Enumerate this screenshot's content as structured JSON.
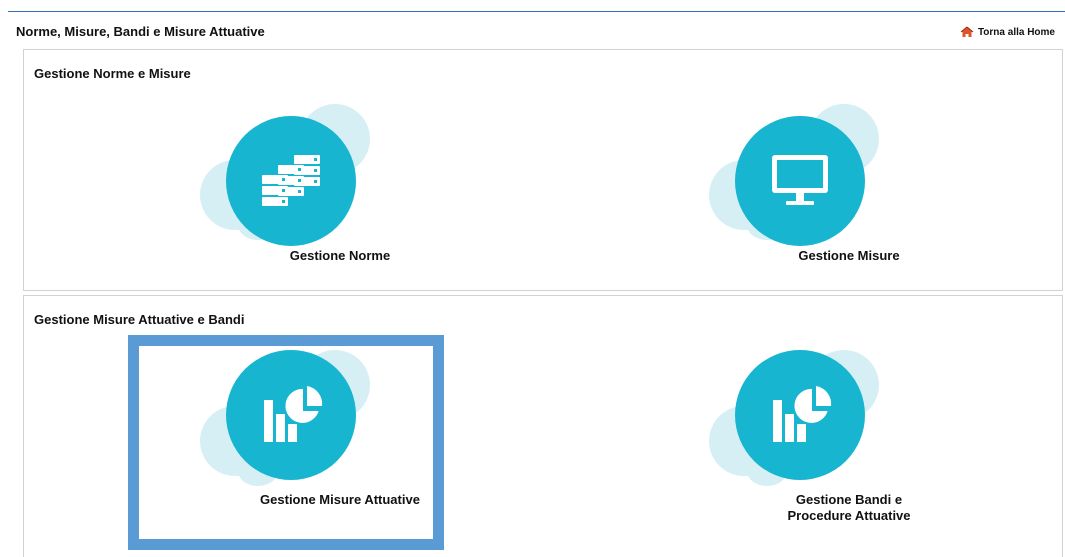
{
  "header": {
    "title": "Norme, Misure, Bandi e Misure Attuative",
    "home_link": "Torna alla Home",
    "home_icon": "home-icon"
  },
  "sections": [
    {
      "title": "Gestione Norme e Misure",
      "tiles": [
        {
          "label": "Gestione Norme",
          "icon": "server-stack-icon"
        },
        {
          "label": "Gestione Misure",
          "icon": "monitor-icon"
        }
      ]
    },
    {
      "title": "Gestione Misure Attuative e Bandi",
      "tiles": [
        {
          "label": "Gestione Misure Attuative",
          "icon": "bar-pie-chart-icon",
          "selected": true
        },
        {
          "label_line1": "Gestione Bandi e",
          "label_line2": "Procedure Attuative",
          "icon": "bar-pie-chart-icon"
        }
      ]
    }
  ],
  "colors": {
    "accent": "#17b5d0",
    "blob": "#d6eff5",
    "selection": "#5a9bd6",
    "top_rule": "#2f6fb3",
    "home_icon": "#e0542a"
  }
}
